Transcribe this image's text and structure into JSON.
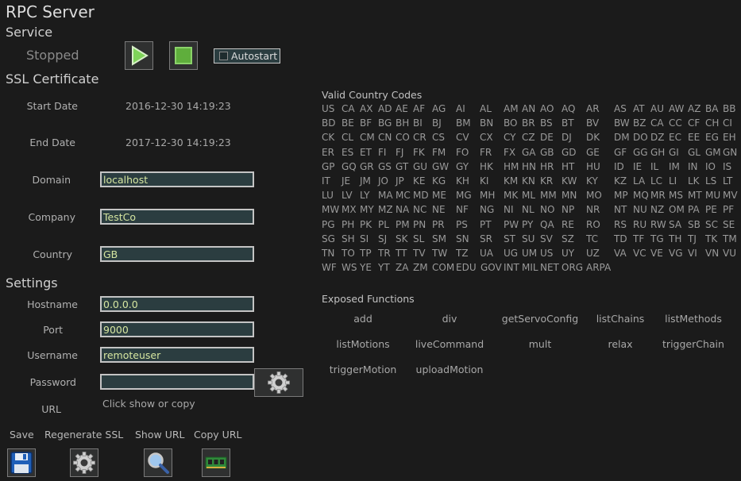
{
  "title": "RPC Server",
  "service": {
    "heading": "Service",
    "status": "Stopped",
    "autostart_label": "Autostart"
  },
  "ssl": {
    "heading": "SSL Certificate",
    "start_label": "Start Date",
    "start_value": "2016-12-30 14:19:23",
    "end_label": "End Date",
    "end_value": "2017-12-30 14:19:23",
    "domain_label": "Domain",
    "domain_value": "localhost",
    "company_label": "Company",
    "company_value": "TestCo",
    "country_label": "Country",
    "country_value": "GB"
  },
  "settings": {
    "heading": "Settings",
    "hostname_label": "Hostname",
    "hostname_value": "0.0.0.0",
    "port_label": "Port",
    "port_value": "9000",
    "username_label": "Username",
    "username_value": "remoteuser",
    "password_label": "Password",
    "password_value": "",
    "url_label": "URL",
    "url_value": "Click show or copy"
  },
  "toolbar": {
    "save": "Save",
    "regenerate": "Regenerate SSL",
    "show_url": "Show URL",
    "copy_url": "Copy URL"
  },
  "countries": {
    "heading": "Valid Country Codes",
    "rows": [
      [
        "US",
        "CA",
        "AX",
        "AD",
        "AE",
        "AF",
        "AG",
        "AI",
        "AL",
        "AM",
        "AN",
        "AO",
        "AQ",
        "AR",
        "AS",
        "AT",
        "AU",
        "AW",
        "AZ",
        "BA",
        "BB"
      ],
      [
        "BD",
        "BE",
        "BF",
        "BG",
        "BH",
        "BI",
        "BJ",
        "BM",
        "BN",
        "BO",
        "BR",
        "BS",
        "BT",
        "BV",
        "BW",
        "BZ",
        "CA",
        "CC",
        "CF",
        "CH",
        "CI"
      ],
      [
        "CK",
        "CL",
        "CM",
        "CN",
        "CO",
        "CR",
        "CS",
        "CV",
        "CX",
        "CY",
        "CZ",
        "DE",
        "DJ",
        "DK",
        "DM",
        "DO",
        "DZ",
        "EC",
        "EE",
        "EG",
        "EH"
      ],
      [
        "ER",
        "ES",
        "ET",
        "FI",
        "FJ",
        "FK",
        "FM",
        "FO",
        "FR",
        "FX",
        "GA",
        "GB",
        "GD",
        "GE",
        "GF",
        "GG",
        "GH",
        "GI",
        "GL",
        "GM",
        "GN"
      ],
      [
        "GP",
        "GQ",
        "GR",
        "GS",
        "GT",
        "GU",
        "GW",
        "GY",
        "HK",
        "HM",
        "HN",
        "HR",
        "HT",
        "HU",
        "ID",
        "IE",
        "IL",
        "IM",
        "IN",
        "IO",
        "IS"
      ],
      [
        "IT",
        "JE",
        "JM",
        "JO",
        "JP",
        "KE",
        "KG",
        "KH",
        "KI",
        "KM",
        "KN",
        "KR",
        "KW",
        "KY",
        "KZ",
        "LA",
        "LC",
        "LI",
        "LK",
        "LS",
        "LT"
      ],
      [
        "LU",
        "LV",
        "LY",
        "MA",
        "MC",
        "MD",
        "ME",
        "MG",
        "MH",
        "MK",
        "ML",
        "MM",
        "MN",
        "MO",
        "MP",
        "MQ",
        "MR",
        "MS",
        "MT",
        "MU",
        "MV"
      ],
      [
        "MW",
        "MX",
        "MY",
        "MZ",
        "NA",
        "NC",
        "NE",
        "NF",
        "NG",
        "NI",
        "NL",
        "NO",
        "NP",
        "NR",
        "NT",
        "NU",
        "NZ",
        "OM",
        "PA",
        "PE",
        "PF"
      ],
      [
        "PG",
        "PH",
        "PK",
        "PL",
        "PM",
        "PN",
        "PR",
        "PS",
        "PT",
        "PW",
        "PY",
        "QA",
        "RE",
        "RO",
        "RS",
        "RU",
        "RW",
        "SA",
        "SB",
        "SC",
        "SE"
      ],
      [
        "SG",
        "SH",
        "SI",
        "SJ",
        "SK",
        "SL",
        "SM",
        "SN",
        "SR",
        "ST",
        "SU",
        "SV",
        "SZ",
        "TC",
        "TD",
        "TF",
        "TG",
        "TH",
        "TJ",
        "TK",
        "TM"
      ],
      [
        "TN",
        "TO",
        "TP",
        "TR",
        "TT",
        "TV",
        "TW",
        "TZ",
        "UA",
        "UG",
        "UM",
        "US",
        "UY",
        "UZ",
        "VA",
        "VC",
        "VE",
        "VG",
        "VI",
        "VN",
        "VU"
      ],
      [
        "WF",
        "WS",
        "YE",
        "YT",
        "ZA",
        "ZM",
        "COM",
        "EDU",
        "GOV",
        "INT",
        "MIL",
        "NET",
        "ORG",
        "ARPA"
      ]
    ]
  },
  "functions": {
    "heading": "Exposed Functions",
    "items": [
      "add",
      "div",
      "getServoConfig",
      "listChains",
      "listMethods",
      "listMotions",
      "liveCommand",
      "mult",
      "relax",
      "triggerChain",
      "triggerMotion",
      "uploadMotion"
    ]
  },
  "colors": {
    "background": "#1b1b1b",
    "field_bg": "#2b3d40",
    "field_text": "#d6e6a0",
    "play_green": "#7fd35a"
  },
  "icons": {
    "start": "play-icon",
    "stop": "stop-icon",
    "gear": "gear-icon",
    "save": "floppy-disk-icon",
    "regenerate": "gear-icon",
    "show_url": "magnifier-icon",
    "copy_url": "memory-chip-icon"
  }
}
